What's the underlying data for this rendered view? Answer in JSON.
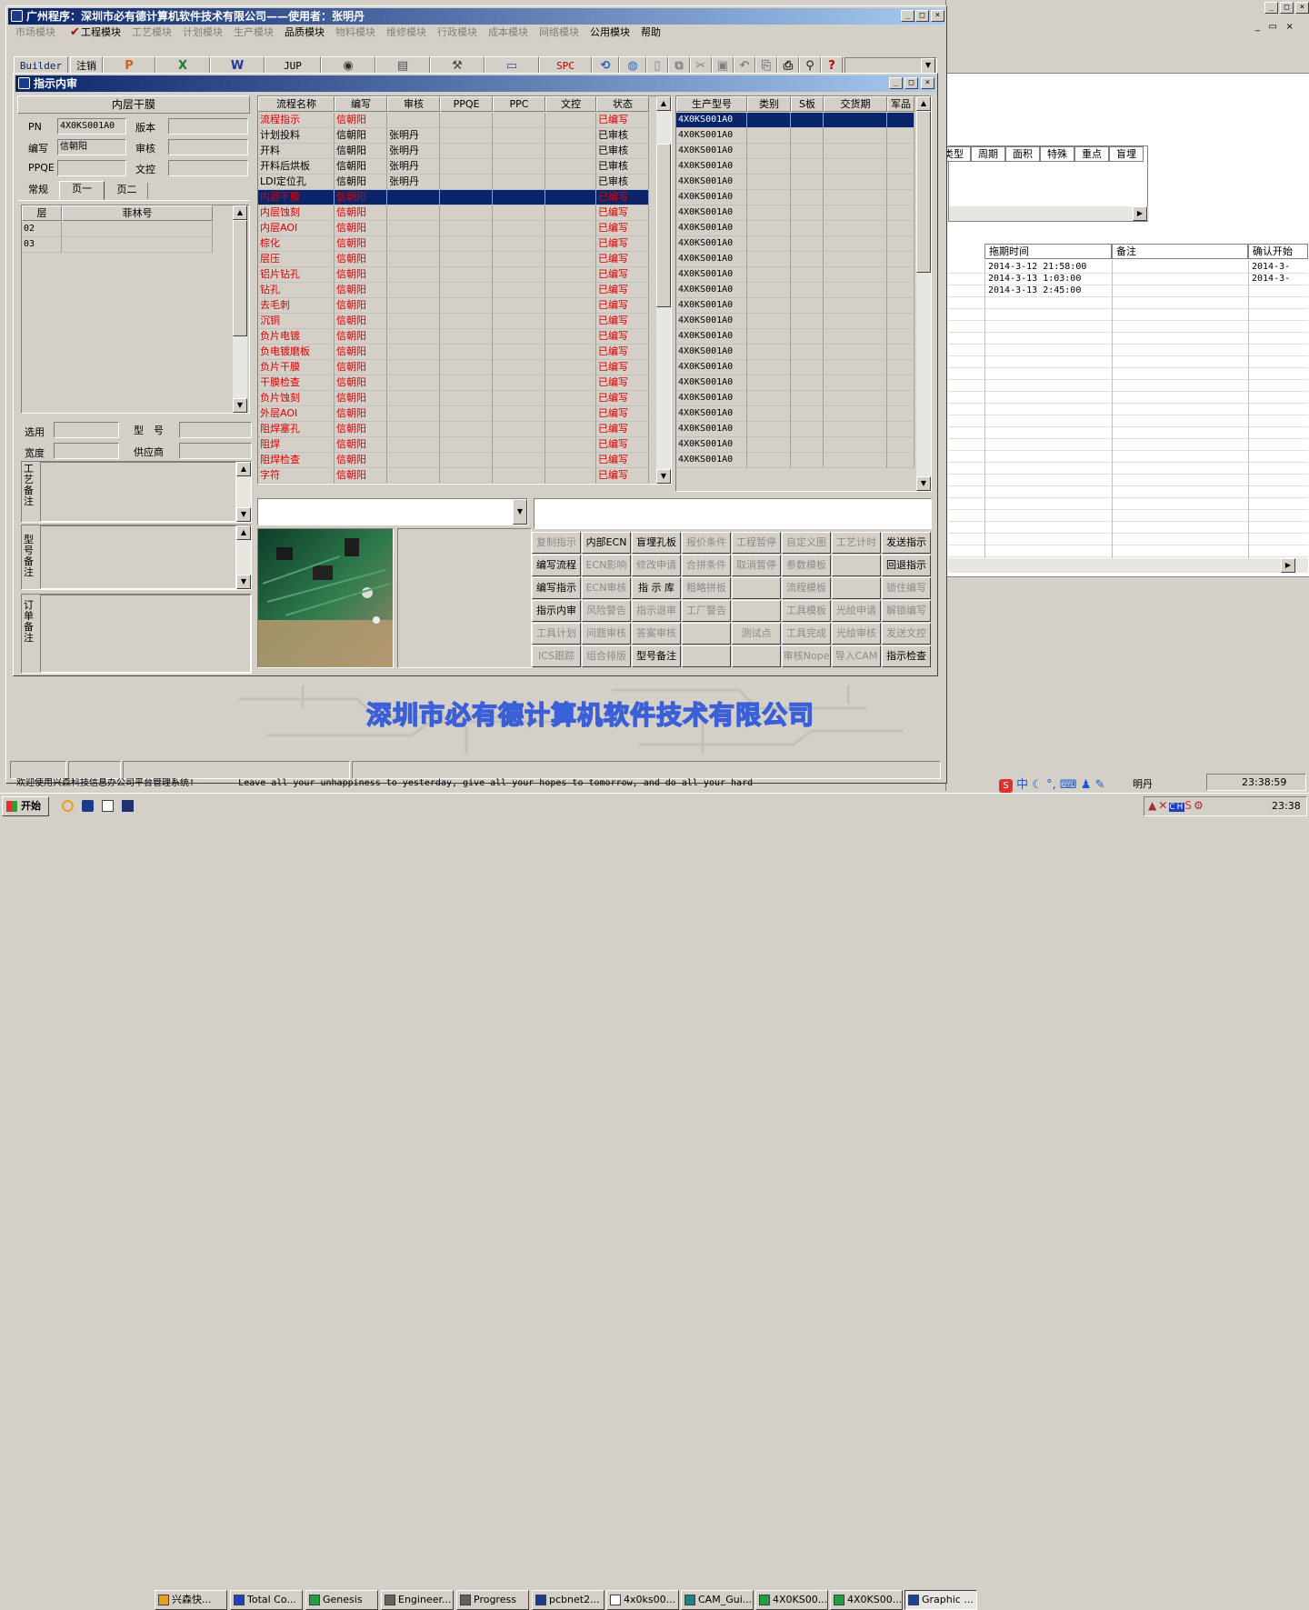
{
  "main_window": {
    "title": "广州程序：深圳市必有德计算机软件技术有限公司——使用者：张明丹",
    "menu": [
      {
        "label": "市场模块",
        "enabled": false
      },
      {
        "label": "工程模块",
        "enabled": true,
        "checked": true
      },
      {
        "label": "工艺模块",
        "enabled": false
      },
      {
        "label": "计划模块",
        "enabled": false
      },
      {
        "label": "生产模块",
        "enabled": false
      },
      {
        "label": "品质模块",
        "enabled": true
      },
      {
        "label": "物料模块",
        "enabled": false
      },
      {
        "label": "维修模块",
        "enabled": false
      },
      {
        "label": "行政模块",
        "enabled": false
      },
      {
        "label": "成本模块",
        "enabled": false
      },
      {
        "label": "网络模块",
        "enabled": false
      },
      {
        "label": "公用模块",
        "enabled": true
      },
      {
        "label": "帮助",
        "enabled": true
      }
    ],
    "toolbar": {
      "builder": "Builder",
      "logout": "注销",
      "jup": "JUP",
      "spc": "SPC"
    },
    "company_banner": "深圳市必有德计算机软件技术有限公司"
  },
  "dialog": {
    "title": "指示内审",
    "section_title": "内层干膜",
    "fields": {
      "pn_label": "PN",
      "pn_value": "4X0KS001A0",
      "version_label": "版本",
      "version_value": "",
      "writer_label": "编写",
      "writer_value": "信朝阳",
      "reviewer_label": "审核",
      "reviewer_value": "",
      "ppqe_label": "PPQE",
      "ppqe_value": "",
      "doc_label": "文控",
      "doc_value": ""
    },
    "tabs": [
      "常规",
      "页一",
      "页二"
    ],
    "layer_table": {
      "headers": [
        "层",
        "菲林号"
      ],
      "rows": [
        [
          "02",
          ""
        ],
        [
          "03",
          ""
        ]
      ]
    },
    "lower_fields": {
      "select_label": "选用",
      "model_label": "型　号",
      "width_label": "宽度",
      "supplier_label": "供应商"
    },
    "notes": {
      "craft": "工艺备注",
      "model": "型号备注",
      "order": "订单备注"
    },
    "flow_table": {
      "headers": [
        "流程名称",
        "编写",
        "审核",
        "PPQE",
        "PPC",
        "文控",
        "状态"
      ],
      "rows": [
        {
          "name": "流程指示",
          "writer": "信朝阳",
          "reviewer": "",
          "status": "已编写",
          "red": true
        },
        {
          "name": "计划投料",
          "writer": "信朝阳",
          "reviewer": "张明丹",
          "status": "已审核",
          "red": false
        },
        {
          "name": "开料",
          "writer": "信朝阳",
          "reviewer": "张明丹",
          "status": "已审核",
          "red": false
        },
        {
          "name": "开料后烘板",
          "writer": "信朝阳",
          "reviewer": "张明丹",
          "status": "已审核",
          "red": false
        },
        {
          "name": "LDI定位孔",
          "writer": "信朝阳",
          "reviewer": "张明丹",
          "status": "已审核",
          "red": false
        },
        {
          "name": "内层干膜",
          "writer": "信朝阳",
          "reviewer": "",
          "status": "已编写",
          "red": true,
          "selected": true
        },
        {
          "name": "内层蚀刻",
          "writer": "信朝阳",
          "reviewer": "",
          "status": "已编写",
          "red": true
        },
        {
          "name": "内层AOI",
          "writer": "信朝阳",
          "reviewer": "",
          "status": "已编写",
          "red": true
        },
        {
          "name": "棕化",
          "writer": "信朝阳",
          "reviewer": "",
          "status": "已编写",
          "red": true
        },
        {
          "name": "层压",
          "writer": "信朝阳",
          "reviewer": "",
          "status": "已编写",
          "red": true
        },
        {
          "name": "铝片钻孔",
          "writer": "信朝阳",
          "reviewer": "",
          "status": "已编写",
          "red": true
        },
        {
          "name": "钻孔",
          "writer": "信朝阳",
          "reviewer": "",
          "status": "已编写",
          "red": true
        },
        {
          "name": "去毛刺",
          "writer": "信朝阳",
          "reviewer": "",
          "status": "已编写",
          "red": true
        },
        {
          "name": "沉铜",
          "writer": "信朝阳",
          "reviewer": "",
          "status": "已编写",
          "red": true
        },
        {
          "name": "负片电镀",
          "writer": "信朝阳",
          "reviewer": "",
          "status": "已编写",
          "red": true
        },
        {
          "name": "负电镀磨板",
          "writer": "信朝阳",
          "reviewer": "",
          "status": "已编写",
          "red": true
        },
        {
          "name": "负片干膜",
          "writer": "信朝阳",
          "reviewer": "",
          "status": "已编写",
          "red": true
        },
        {
          "name": "干膜检查",
          "writer": "信朝阳",
          "reviewer": "",
          "status": "已编写",
          "red": true
        },
        {
          "name": "负片蚀刻",
          "writer": "信朝阳",
          "reviewer": "",
          "status": "已编写",
          "red": true
        },
        {
          "name": "外层AOI",
          "writer": "信朝阳",
          "reviewer": "",
          "status": "已编写",
          "red": true
        },
        {
          "name": "阻焊塞孔",
          "writer": "信朝阳",
          "reviewer": "",
          "status": "已编写",
          "red": true
        },
        {
          "name": "阻焊",
          "writer": "信朝阳",
          "reviewer": "",
          "status": "已编写",
          "red": true
        },
        {
          "name": "阻焊检查",
          "writer": "信朝阳",
          "reviewer": "",
          "status": "已编写",
          "red": true
        },
        {
          "name": "字符",
          "writer": "信朝阳",
          "reviewer": "",
          "status": "已编写",
          "red": true
        }
      ]
    },
    "model_table": {
      "headers": [
        "生产型号",
        "类别",
        "S板",
        "交货期",
        "军品"
      ],
      "value": "4X0KS001A0",
      "row_count": 23
    },
    "action_buttons": [
      [
        {
          "l": "复制指示",
          "e": false
        },
        {
          "l": "内部ECN",
          "e": true
        },
        {
          "l": "盲埋孔板",
          "e": true
        },
        {
          "l": "报价条件",
          "e": false
        },
        {
          "l": "工程暂停",
          "e": false
        },
        {
          "l": "自定义图",
          "e": false
        },
        {
          "l": "工艺计时",
          "e": false
        },
        {
          "l": "发送指示",
          "e": true
        }
      ],
      [
        {
          "l": "编写流程",
          "e": true
        },
        {
          "l": "ECN影响",
          "e": false
        },
        {
          "l": "修改申请",
          "e": false
        },
        {
          "l": "合拼条件",
          "e": false
        },
        {
          "l": "取消暂停",
          "e": false
        },
        {
          "l": "参数模板",
          "e": false
        },
        {
          "l": "",
          "e": false
        },
        {
          "l": "回退指示",
          "e": true
        }
      ],
      [
        {
          "l": "编写指示",
          "e": true
        },
        {
          "l": "ECN审核",
          "e": false
        },
        {
          "l": "指 示 库",
          "e": true
        },
        {
          "l": "粗略拼板",
          "e": false
        },
        {
          "l": "",
          "e": false
        },
        {
          "l": "流程模板",
          "e": false
        },
        {
          "l": "",
          "e": false
        },
        {
          "l": "锁住编写",
          "e": false
        }
      ],
      [
        {
          "l": "指示内审",
          "e": true
        },
        {
          "l": "风险警告",
          "e": false
        },
        {
          "l": "指示退审",
          "e": false
        },
        {
          "l": "工厂警告",
          "e": false
        },
        {
          "l": "",
          "e": false
        },
        {
          "l": "工具模板",
          "e": false
        },
        {
          "l": "光绘申请",
          "e": false
        },
        {
          "l": "解锁编写",
          "e": false
        }
      ],
      [
        {
          "l": "工具计划",
          "e": false
        },
        {
          "l": "问题审核",
          "e": false
        },
        {
          "l": "答案审核",
          "e": false
        },
        {
          "l": "",
          "e": false
        },
        {
          "l": "测试点",
          "e": false
        },
        {
          "l": "工具完成",
          "e": false
        },
        {
          "l": "光绘审核",
          "e": false
        },
        {
          "l": "发送文控",
          "e": false
        }
      ],
      [
        {
          "l": "ICS跟踪",
          "e": false
        },
        {
          "l": "组合排版",
          "e": false
        },
        {
          "l": "型号备注",
          "e": true
        },
        {
          "l": "",
          "e": false
        },
        {
          "l": "",
          "e": false
        },
        {
          "l": "审核Nope",
          "e": false
        },
        {
          "l": "导入CAM",
          "e": false
        },
        {
          "l": "指示检查",
          "e": true
        }
      ]
    ]
  },
  "background": {
    "grid1_headers": [
      "类型",
      "周期",
      "面积",
      "特殊",
      "重点",
      "盲埋"
    ],
    "grid2_headers": [
      "拖期时间",
      "备注",
      "确认开始"
    ],
    "grid2_rows": [
      "2014-3-12 21:58:00",
      "2014-3-13 1:03:00",
      "2014-3-13 2:45:00"
    ],
    "grid2_right": [
      "2014-3-",
      "2014-3-"
    ],
    "marquee": "欢迎使用兴森科技信息办公司平台管理系统!        Leave all your unhappiness to yesterday, give all your hopes to tomorrow, and do all your hard",
    "status_user": "明丹",
    "status_time": "23:38:59"
  },
  "taskbar": {
    "start": "开始",
    "items": [
      "兴森快...",
      "Total Co...",
      "Genesis",
      "Engineer...",
      "Progress",
      "pcbnet2...",
      "4x0ks00...",
      "CAM_Gui...",
      "4X0KS00...",
      "4X0KS00...",
      "Graphic ..."
    ],
    "clock": "23:38",
    "ime": "中"
  },
  "colors": {
    "title_active": "#0a246a",
    "title_grad": "#a6caf0",
    "red": "#e00000",
    "banner": "#4a6ee0"
  }
}
